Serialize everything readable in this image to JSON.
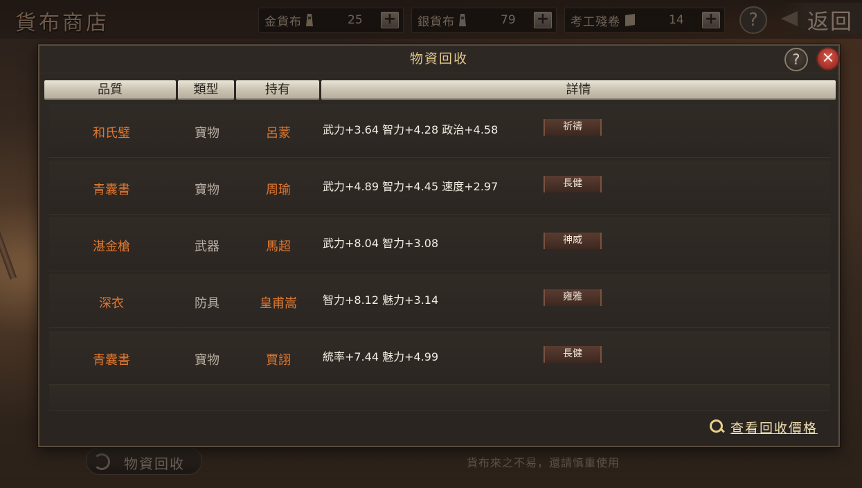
{
  "header": {
    "shop_title": "貨布商店",
    "currencies": [
      {
        "label": "金貨布",
        "value": "25",
        "icon": "gold-coin-icon"
      },
      {
        "label": "銀貨布",
        "value": "79",
        "icon": "silver-coin-icon"
      },
      {
        "label": "考工殘卷",
        "value": "14",
        "icon": "scroll-icon"
      }
    ],
    "plus": "+",
    "help": "?",
    "return_label": "返回"
  },
  "bottom": {
    "recycle_label": "物資回收",
    "tip": "貨布來之不易，還請慎重使用"
  },
  "dialog": {
    "title": "物資回收",
    "help": "?",
    "close": "✕",
    "columns": [
      "品質",
      "類型",
      "持有",
      "詳情"
    ],
    "rows": [
      {
        "quality": "和氏璧",
        "type": "寶物",
        "owner": "呂蒙",
        "attrs": "武力+3.64  智力+4.28  政治+4.58",
        "badge": "祈禱"
      },
      {
        "quality": "青囊書",
        "type": "寶物",
        "owner": "周瑜",
        "attrs": "武力+4.89  智力+4.45  速度+2.97",
        "badge": "長健"
      },
      {
        "quality": "湛金槍",
        "type": "武器",
        "owner": "馬超",
        "attrs": "武力+8.04  智力+3.08",
        "badge": "神威"
      },
      {
        "quality": "深衣",
        "type": "防具",
        "owner": "皇甫嵩",
        "attrs": "智力+8.12  魅力+3.14",
        "badge": "雍雅"
      },
      {
        "quality": "青囊書",
        "type": "寶物",
        "owner": "賈詡",
        "attrs": "統率+7.44  魅力+4.99",
        "badge": "長健"
      }
    ],
    "price_link": "查看回收價格"
  },
  "colors": {
    "accent_orange": "#e0772f",
    "title_gold": "#e3c88b",
    "close_red": "#c23a2e"
  }
}
